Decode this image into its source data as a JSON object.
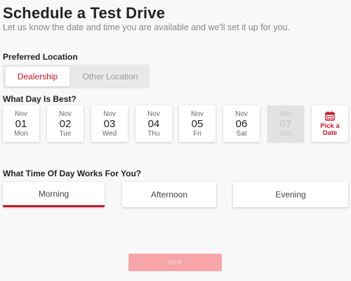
{
  "header": {
    "title": "Schedule a Test Drive",
    "subtitle": "Let us know the date and time you are available and we'll set it up for you."
  },
  "location": {
    "label": "Preferred Location",
    "options": [
      "Dealership",
      "Other Location"
    ],
    "selected": "Dealership"
  },
  "days": {
    "label": "What Day Is Best?",
    "items": [
      {
        "month": "Nov",
        "day": "01",
        "weekday": "Mon",
        "available": true
      },
      {
        "month": "Nov",
        "day": "02",
        "weekday": "Tue",
        "available": true
      },
      {
        "month": "Nov",
        "day": "03",
        "weekday": "Wed",
        "available": true
      },
      {
        "month": "Nov",
        "day": "04",
        "weekday": "Thu",
        "available": true
      },
      {
        "month": "Nov",
        "day": "05",
        "weekday": "Fri",
        "available": true
      },
      {
        "month": "Nov",
        "day": "06",
        "weekday": "Sat",
        "available": true
      },
      {
        "month": "Nov",
        "day": "07",
        "weekday": "Sun",
        "available": false
      }
    ],
    "pick_date_label": "Pick a Date",
    "pick_date_icon": "calendar-icon"
  },
  "time": {
    "label": "What Time Of Day Works For You?",
    "options": [
      "Morning",
      "Afternoon",
      "Evening"
    ],
    "selected": "Morning"
  },
  "footer": {
    "next_label": "next"
  },
  "colors": {
    "accent": "#c4162a",
    "next_disabled": "#f6a5a8",
    "background": "#f8f8f8"
  }
}
